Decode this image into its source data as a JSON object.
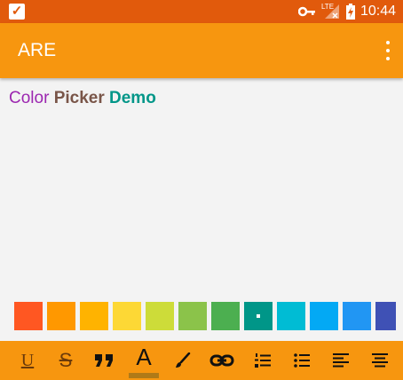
{
  "status_bar": {
    "time": "10:44",
    "network": "LTE",
    "icons": [
      "app-check-icon",
      "vpn-key-icon",
      "signal-lte-icon",
      "battery-charging-icon"
    ]
  },
  "app_bar": {
    "title": "ARE",
    "menu_icon": "overflow-menu-icon"
  },
  "editor": {
    "words": [
      {
        "text": "Color",
        "color": "#9c27b0",
        "bold": false
      },
      {
        "text": "Picker",
        "color": "#795548",
        "bold": true
      },
      {
        "text": "Demo",
        "color": "#009688",
        "bold": true
      }
    ]
  },
  "palette": {
    "colors": [
      "#ff5722",
      "#ff9800",
      "#ffb300",
      "#fdd835",
      "#cddc39",
      "#8bc34a",
      "#4caf50",
      "#009688",
      "#00bcd4",
      "#03a9f4",
      "#2196f3",
      "#3f51b5"
    ],
    "selected_index": 7
  },
  "toolbar": {
    "underline_label": "U",
    "strike_label": "S",
    "fontcolor_label": "A",
    "items": [
      "underline-icon",
      "strikethrough-icon",
      "quote-icon",
      "font-color-icon",
      "brush-icon",
      "link-icon",
      "numbered-list-icon",
      "bullet-list-icon",
      "align-left-icon",
      "align-center-icon"
    ]
  }
}
